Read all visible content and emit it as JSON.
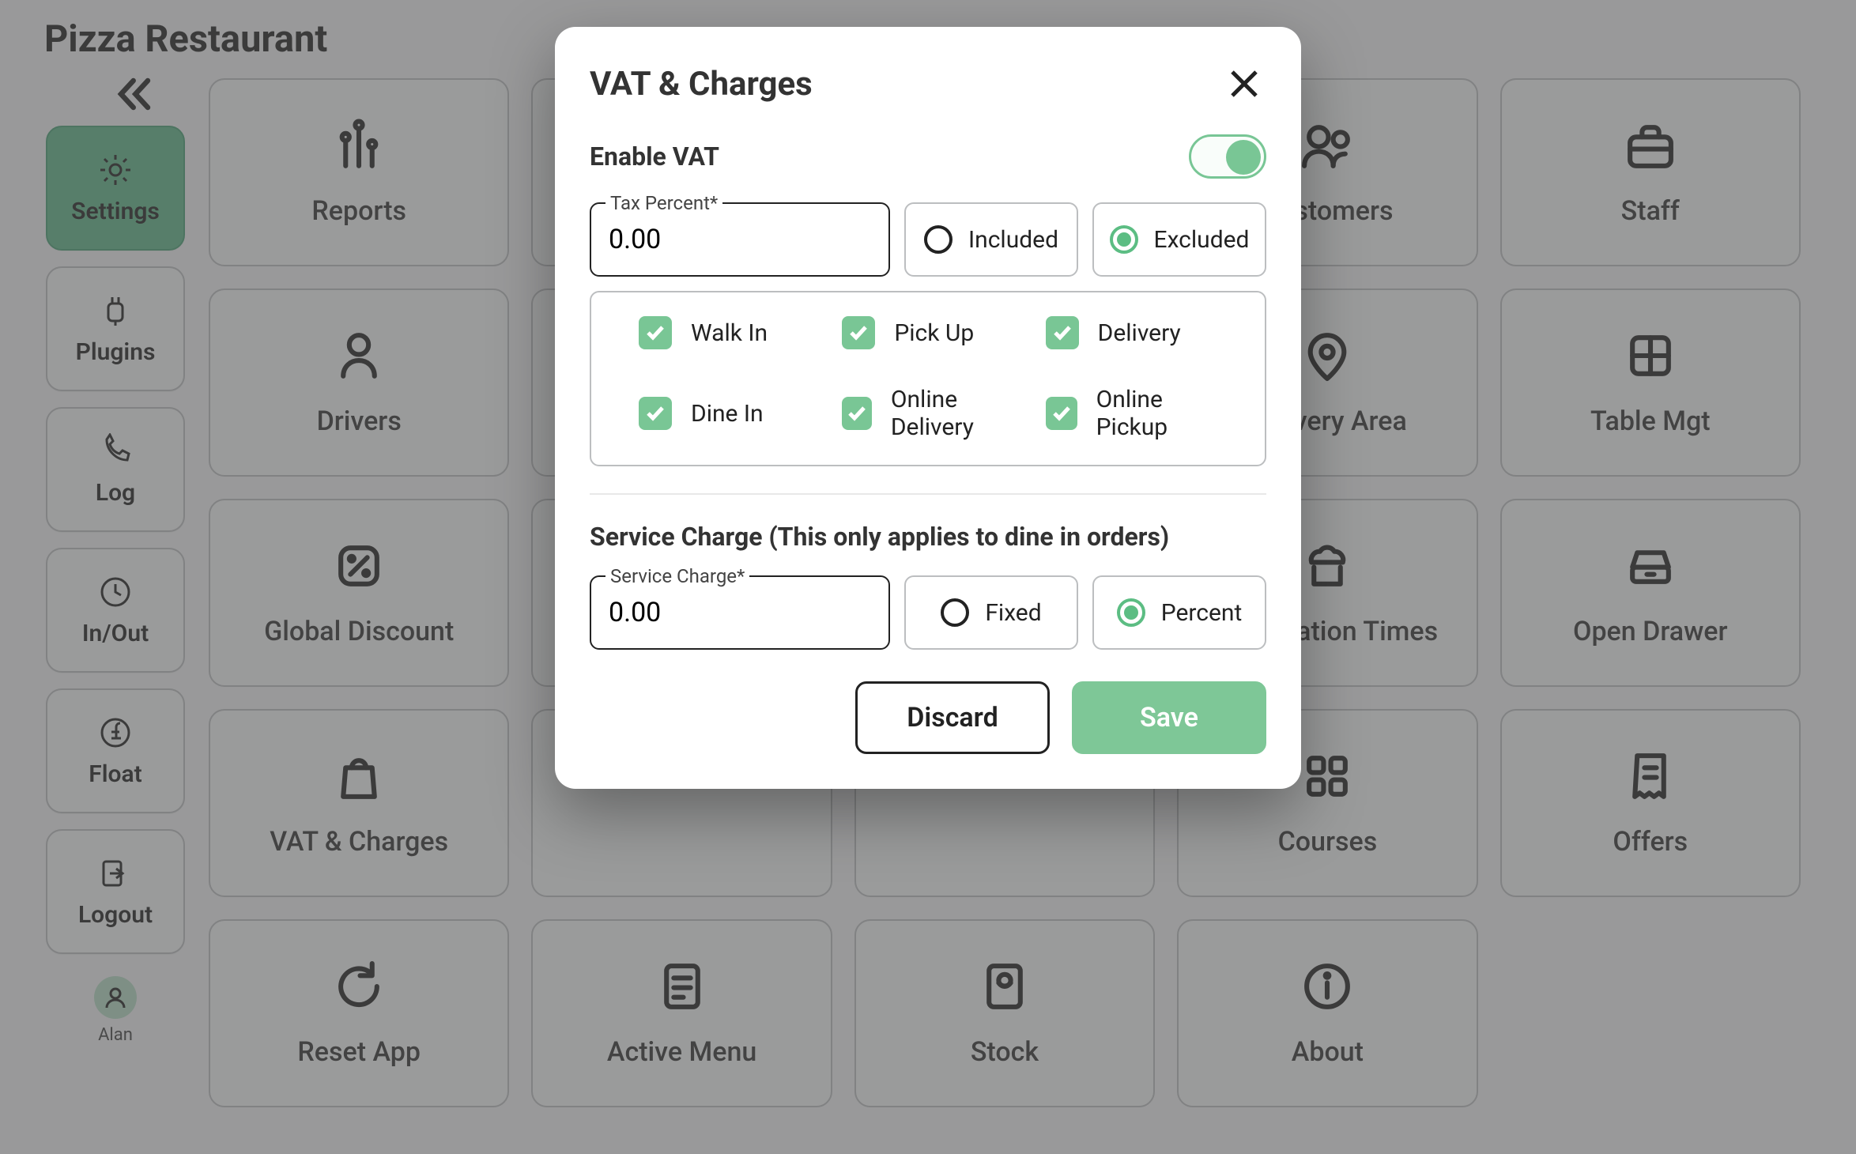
{
  "header": {
    "title": "Pizza Restaurant"
  },
  "sidebar": {
    "items": [
      {
        "label": "Settings",
        "icon": "gear-icon",
        "active": true
      },
      {
        "label": "Plugins",
        "icon": "plug-icon"
      },
      {
        "label": "Log",
        "icon": "phone-icon"
      },
      {
        "label": "In/Out",
        "icon": "clock-icon"
      },
      {
        "label": "Float",
        "icon": "pound-icon"
      },
      {
        "label": "Logout",
        "icon": "logout-icon"
      }
    ],
    "user": {
      "name": "Alan"
    }
  },
  "tiles": [
    {
      "label": "Reports",
      "icon": "bars-icon"
    },
    {
      "label": "",
      "icon": ""
    },
    {
      "label": "",
      "icon": ""
    },
    {
      "label": "Customers",
      "icon": "users-icon"
    },
    {
      "label": "Staff",
      "icon": "briefcase-icon"
    },
    {
      "label": "Drivers",
      "icon": "driver-icon"
    },
    {
      "label": "",
      "icon": ""
    },
    {
      "label": "",
      "icon": ""
    },
    {
      "label": "Delivery Area",
      "icon": "map-pin-icon"
    },
    {
      "label": "Table Mgt",
      "icon": "grid-icon"
    },
    {
      "label": "Global Discount",
      "icon": "discount-icon"
    },
    {
      "label": "",
      "icon": ""
    },
    {
      "label": "",
      "icon": ""
    },
    {
      "label": "Preparation Times",
      "icon": "chef-icon"
    },
    {
      "label": "Open Drawer",
      "icon": "drawer-icon"
    },
    {
      "label": "VAT & Charges",
      "icon": "bag-icon"
    },
    {
      "label": "",
      "icon": ""
    },
    {
      "label": "",
      "icon": ""
    },
    {
      "label": "Courses",
      "icon": "courses-icon"
    },
    {
      "label": "Offers",
      "icon": "receipt-icon"
    },
    {
      "label": "Reset App",
      "icon": "reset-icon"
    },
    {
      "label": "Active Menu",
      "icon": "menu-icon"
    },
    {
      "label": "Stock",
      "icon": "stock-icon"
    },
    {
      "label": "About",
      "icon": "info-icon"
    }
  ],
  "modal": {
    "title": "VAT & Charges",
    "enable_label": "Enable VAT",
    "enable_value": true,
    "tax": {
      "label": "Tax Percent*",
      "value": "0.00",
      "options": {
        "included": "Included",
        "excluded": "Excluded"
      },
      "selected": "excluded",
      "types": [
        {
          "label": "Walk In",
          "checked": true
        },
        {
          "label": "Pick Up",
          "checked": true
        },
        {
          "label": "Delivery",
          "checked": true
        },
        {
          "label": "Dine In",
          "checked": true
        },
        {
          "label": "Online Delivery",
          "checked": true
        },
        {
          "label": "Online Pickup",
          "checked": true
        }
      ]
    },
    "service": {
      "heading": "Service Charge (This only applies to dine in orders)",
      "label": "Service Charge*",
      "value": "0.00",
      "options": {
        "fixed": "Fixed",
        "percent": "Percent"
      },
      "selected": "percent"
    },
    "actions": {
      "discard": "Discard",
      "save": "Save"
    }
  }
}
